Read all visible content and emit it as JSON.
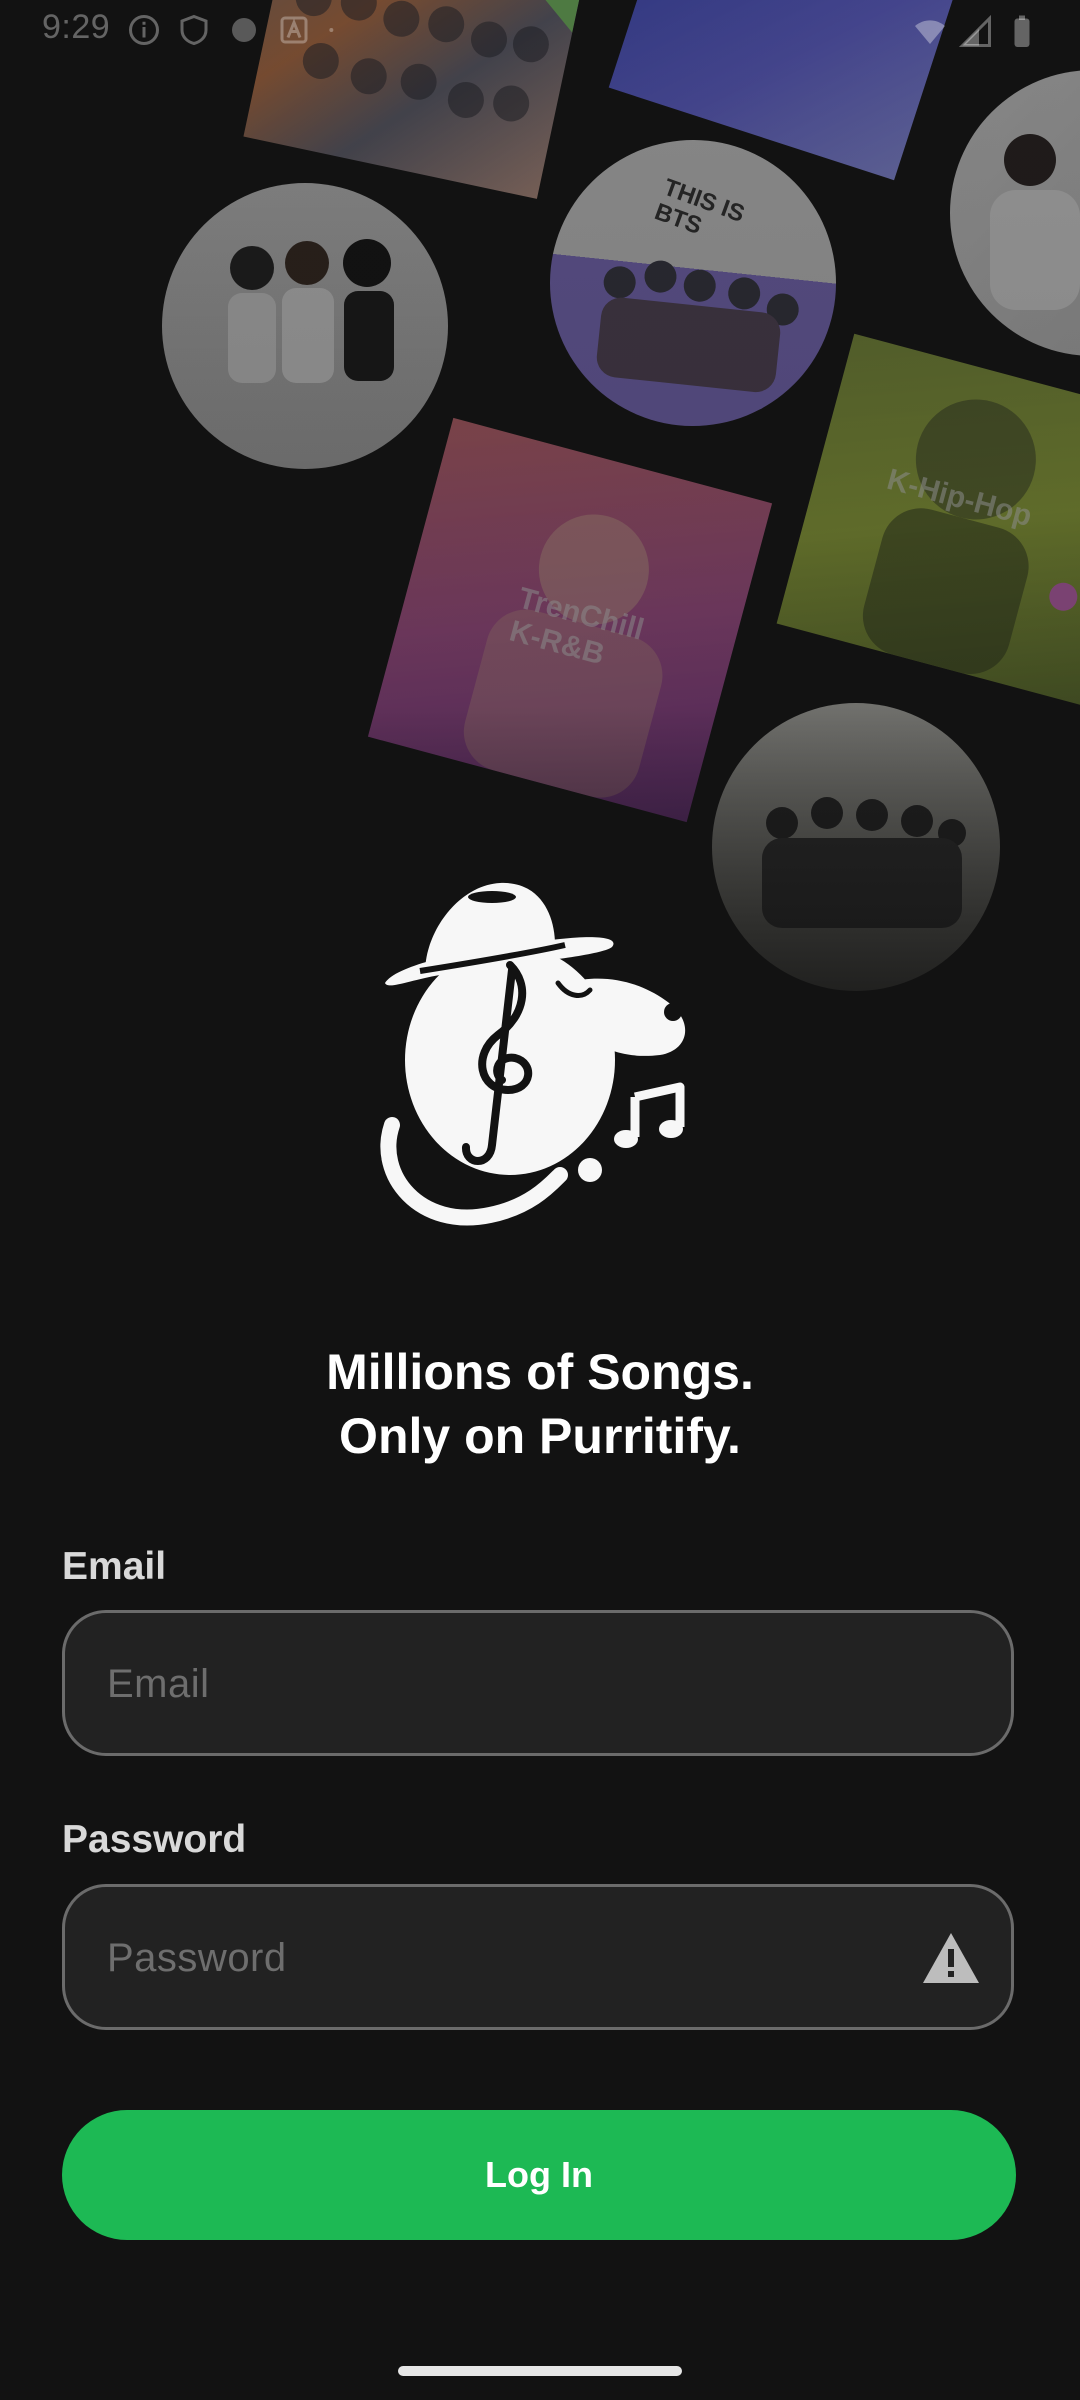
{
  "status_bar": {
    "time": "9:29",
    "left_icons": [
      "info-icon",
      "shield-icon",
      "app-notification-icon",
      "font-icon",
      "dot-icon"
    ],
    "right_icons": [
      "wifi-icon",
      "signal-icon",
      "battery-icon"
    ]
  },
  "collage": {
    "items": [
      {
        "name": "group-photo-art",
        "shape": "square",
        "label": ""
      },
      {
        "name": "blue-playlist-art",
        "shape": "square",
        "label": ""
      },
      {
        "name": "artist-circle-1",
        "shape": "circle",
        "label": ""
      },
      {
        "name": "this-is-bts-art",
        "shape": "circle",
        "label": "THIS IS BTS"
      },
      {
        "name": "artist-circle-2",
        "shape": "circle",
        "label": ""
      },
      {
        "name": "trenchill-krnb-art",
        "shape": "square",
        "label": "TrenChill K-R&B"
      },
      {
        "name": "k-hip-hop-art",
        "shape": "square",
        "label": "K-Hip-Hop"
      },
      {
        "name": "artist-circle-3",
        "shape": "circle",
        "label": ""
      }
    ]
  },
  "brand": {
    "logo": "dog-with-hat-and-music-note-logo",
    "tagline_line1": "Millions of Songs.",
    "tagline_line2": "Only on Purritify."
  },
  "form": {
    "email_label": "Email",
    "email_placeholder": "Email",
    "email_value": "",
    "password_label": "Password",
    "password_placeholder": "Password",
    "password_value": "",
    "password_icon": "warning-icon",
    "login_label": "Log In"
  },
  "colors": {
    "background": "#121212",
    "accent": "#1db954",
    "field_background": "#222222",
    "field_border": "#6b6b6b"
  }
}
